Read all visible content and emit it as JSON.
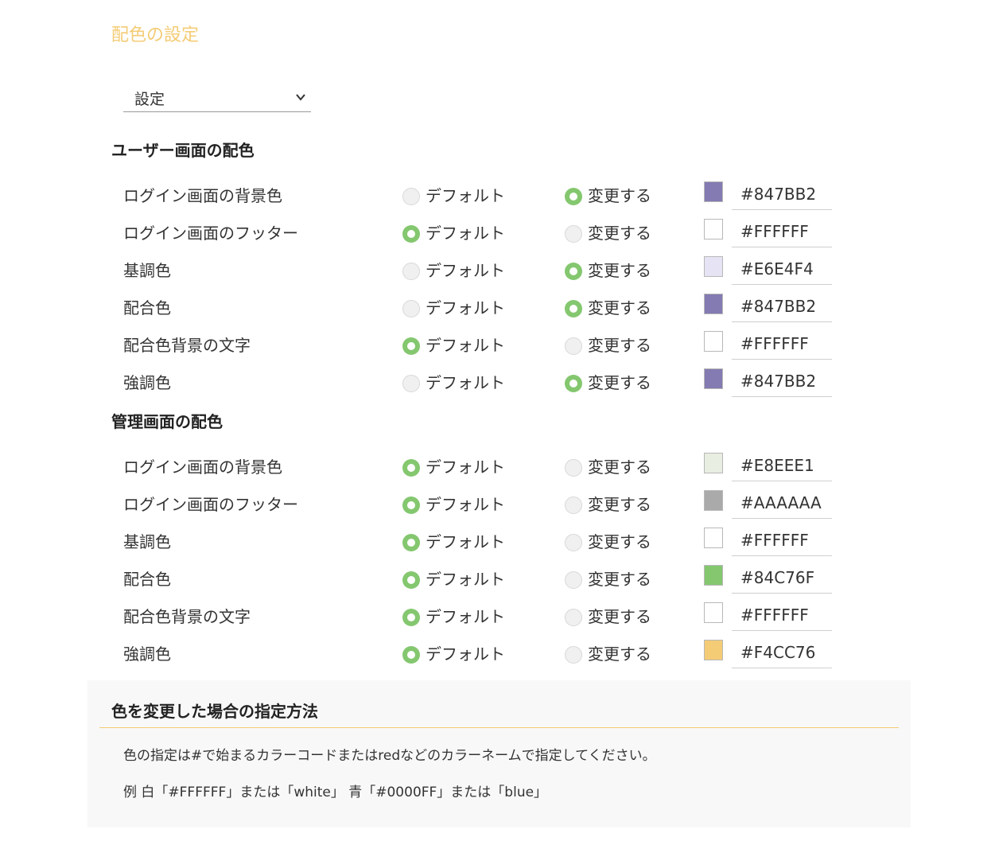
{
  "page": {
    "title": "配色の設定"
  },
  "select": {
    "value": "設定"
  },
  "radio_labels": {
    "default": "デフォルト",
    "change": "変更する"
  },
  "user_section": {
    "title": "ユーザー画面の配色",
    "rows": [
      {
        "label": "ログイン画面の背景色",
        "mode": "change",
        "color": "#847BB2",
        "value": "#847BB2"
      },
      {
        "label": "ログイン画面のフッター",
        "mode": "default",
        "color": "#FFFFFF",
        "value": "#FFFFFF"
      },
      {
        "label": "基調色",
        "mode": "change",
        "color": "#E6E4F4",
        "value": "#E6E4F4"
      },
      {
        "label": "配合色",
        "mode": "change",
        "color": "#847BB2",
        "value": "#847BB2"
      },
      {
        "label": "配合色背景の文字",
        "mode": "default",
        "color": "#FFFFFF",
        "value": "#FFFFFF"
      },
      {
        "label": "強調色",
        "mode": "change",
        "color": "#847BB2",
        "value": "#847BB2"
      }
    ]
  },
  "admin_section": {
    "title": "管理画面の配色",
    "rows": [
      {
        "label": "ログイン画面の背景色",
        "mode": "default",
        "color": "#E8EEE1",
        "value": "#E8EEE1"
      },
      {
        "label": "ログイン画面のフッター",
        "mode": "default",
        "color": "#AAAAAA",
        "value": "#AAAAAA"
      },
      {
        "label": "基調色",
        "mode": "default",
        "color": "#FFFFFF",
        "value": "#FFFFFF"
      },
      {
        "label": "配合色",
        "mode": "default",
        "color": "#84C76F",
        "value": "#84C76F"
      },
      {
        "label": "配合色背景の文字",
        "mode": "default",
        "color": "#FFFFFF",
        "value": "#FFFFFF"
      },
      {
        "label": "強調色",
        "mode": "default",
        "color": "#F4CC76",
        "value": "#F4CC76"
      }
    ]
  },
  "info": {
    "title": "色を変更した場合の指定方法",
    "line1": "色の指定は#で始まるカラーコードまたはredなどのカラーネームで指定してください。",
    "line2": "例 白「#FFFFFF」または「white」 青「#0000FF」または「blue」"
  },
  "colors": {
    "accent": "#F4CC76",
    "radio_on": "#84C76F"
  }
}
